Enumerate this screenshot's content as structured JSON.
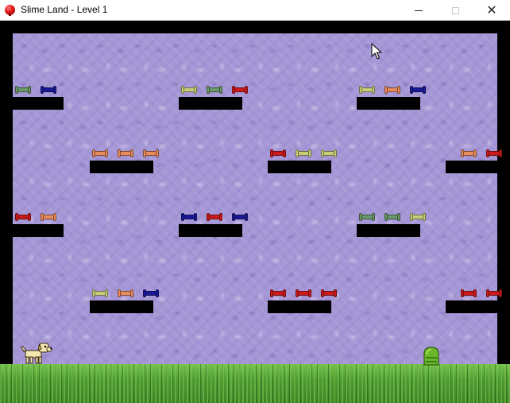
{
  "window": {
    "title": "Slime Land - Level 1",
    "icon": "red-ball-icon",
    "controls": {
      "minimize": "minimize-icon",
      "maximize": "maximize-icon",
      "close": "close-icon",
      "close_glyph": "✕"
    }
  },
  "game": {
    "level": 1,
    "colors": {
      "background": "#a596d6",
      "walls": "#000000",
      "grass": "#4f9a32",
      "bone_red": "#cc1a1a",
      "bone_blue": "#1a1a99",
      "bone_orange": "#e88a5a",
      "bone_green": "#6a9a6a",
      "bone_yellow": "#c8cc78"
    },
    "player": {
      "character": "dog",
      "icon": "dog-icon"
    },
    "enemy": {
      "character": "slime",
      "icon": "slime-icon",
      "color": "#6ab82a"
    },
    "platform_rows": [
      [
        {
          "bones": [
            "green",
            "blue"
          ]
        },
        {
          "bones": [
            "yellow",
            "green",
            "red"
          ]
        },
        {
          "bones": [
            "yellow",
            "orange",
            "blue"
          ]
        }
      ],
      [
        {
          "bones": [
            "orange",
            "orange",
            "orange"
          ]
        },
        {
          "bones": [
            "red",
            "yellow",
            "yellow"
          ]
        },
        {
          "bones": [
            "orange",
            "red"
          ]
        }
      ],
      [
        {
          "bones": [
            "red",
            "orange"
          ]
        },
        {
          "bones": [
            "blue",
            "red",
            "blue"
          ]
        },
        {
          "bones": [
            "green",
            "green",
            "yellow"
          ]
        }
      ],
      [
        {
          "bones": [
            "yellow",
            "orange",
            "blue"
          ]
        },
        {
          "bones": [
            "red",
            "red",
            "red"
          ]
        },
        {
          "bones": [
            "red",
            "red"
          ]
        }
      ]
    ]
  }
}
